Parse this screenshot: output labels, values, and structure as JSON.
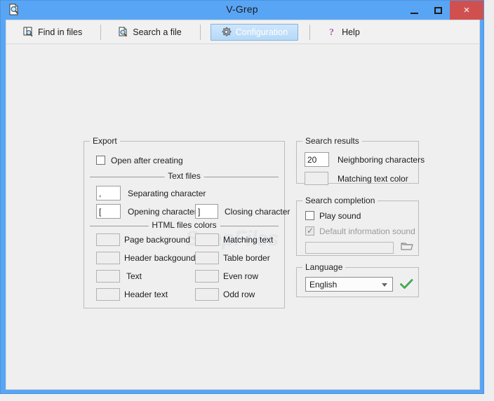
{
  "window": {
    "title": "V-Grep",
    "icon": "document-search-icon",
    "buttons": {
      "minimize": "–",
      "maximize": "□",
      "close": "×"
    }
  },
  "toolbar": {
    "items": [
      {
        "label": "Find in files",
        "icon": "find-in-files-icon",
        "selected": false
      },
      {
        "label": "Search a file",
        "icon": "search-file-icon",
        "selected": false
      },
      {
        "label": "Configuration",
        "icon": "gear-icon",
        "selected": true
      },
      {
        "label": "Help",
        "icon": "question-mark-icon",
        "selected": false
      }
    ]
  },
  "export": {
    "legend": "Export",
    "open_after_creating": {
      "label": "Open after creating",
      "checked": false
    },
    "text_files": {
      "legend": "Text files",
      "separating_character": {
        "value": ",",
        "label": "Separating character"
      },
      "opening_character": {
        "value": "[",
        "label": "Opening character"
      },
      "closing_character": {
        "value": "]",
        "label": "Closing character"
      }
    },
    "html_colors": {
      "legend": "HTML files colors",
      "left": [
        {
          "label": "Page background",
          "color": "#eeeeee"
        },
        {
          "label": "Header backgound",
          "color": "#eeeeee"
        },
        {
          "label": "Text",
          "color": "#eeeeee"
        },
        {
          "label": "Header text",
          "color": "#eeeeee"
        }
      ],
      "right": [
        {
          "label": "Matching text",
          "color": "#eeeeee"
        },
        {
          "label": "Table border",
          "color": "#eeeeee"
        },
        {
          "label": "Even row",
          "color": "#eeeeee"
        },
        {
          "label": "Odd row",
          "color": "#eeeeee"
        }
      ]
    }
  },
  "search_results": {
    "legend": "Search results",
    "neighboring_characters": {
      "value": "20",
      "label": "Neighboring characters"
    },
    "matching_text_color": {
      "label": "Matching text color",
      "color": "#eeeeee"
    }
  },
  "search_completion": {
    "legend": "Search completion",
    "play_sound": {
      "label": "Play sound",
      "checked": false
    },
    "default_information_sound": {
      "label": "Default information sound",
      "checked": true,
      "disabled": true
    },
    "sound_path": {
      "value": "",
      "placeholder": ""
    },
    "browse_icon": "open-folder-icon"
  },
  "language": {
    "legend": "Language",
    "selected": "English",
    "options": [
      "English"
    ],
    "confirm_icon": "green-check-icon"
  },
  "watermark": {
    "text": "SnapFiles"
  },
  "colors": {
    "title_bar": "#59a5f5",
    "close_button": "#d05050",
    "client_bg": "#efefef",
    "selected_tab_border": "#7fb4e0",
    "group_border": "#bcbcbc"
  }
}
